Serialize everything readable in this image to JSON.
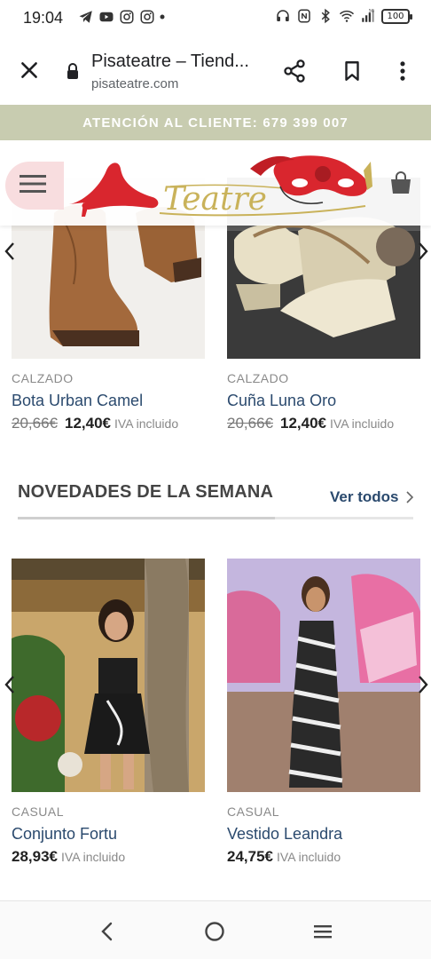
{
  "status_bar": {
    "time": "19:04",
    "battery": "100",
    "network": "5G"
  },
  "browser": {
    "title": "Pisateatre – Tiend...",
    "url": "pisateatre.com"
  },
  "announcement": "ATENCIÓN AL CLIENTE: 679 399 007",
  "header": {
    "logo_text": "Teatre"
  },
  "sale_products": [
    {
      "category": "CALZADO",
      "name": "Bota Urban Camel",
      "old_price": "20,66€",
      "price": "12,40€",
      "vat": "IVA incluido"
    },
    {
      "category": "CALZADO",
      "name": "Cuña Luna Oro",
      "old_price": "20,66€",
      "price": "12,40€",
      "vat": "IVA incluido"
    }
  ],
  "new_section": {
    "title": "NOVEDADES DE LA SEMANA",
    "view_all": "Ver todos"
  },
  "new_products": [
    {
      "category": "CASUAL",
      "name": "Conjunto Fortu",
      "price": "28,93€",
      "vat": "IVA incluido"
    },
    {
      "category": "CASUAL",
      "name": "Vestido Leandra",
      "price": "24,75€",
      "vat": "IVA incluido"
    }
  ],
  "colors": {
    "announcement_bg": "#c8ccb0",
    "product_name": "#2b4a6e",
    "logo_red": "#d9262e",
    "logo_gold": "#c9b25a"
  }
}
